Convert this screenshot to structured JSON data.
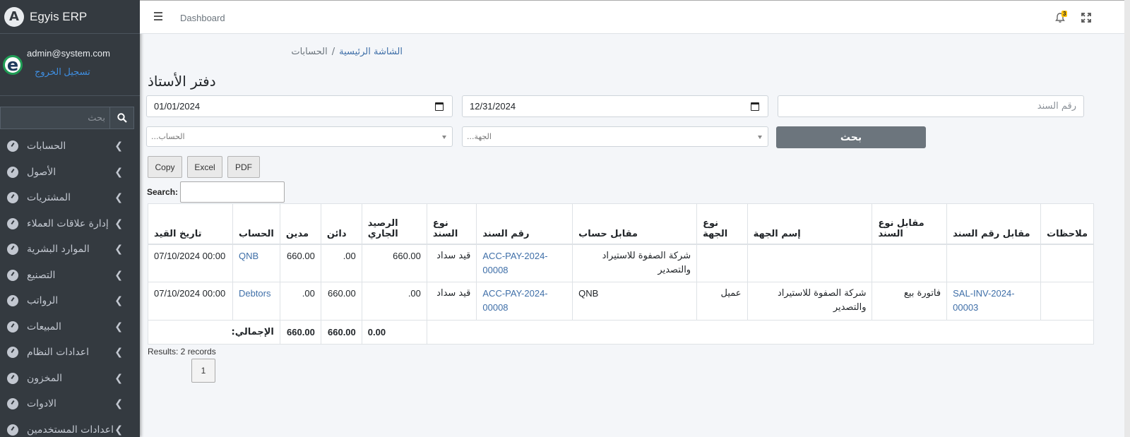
{
  "brand": {
    "logo_letter": "A",
    "name": "Egyis ERP"
  },
  "user": {
    "avatar_letter": "e",
    "email": "admin@system.com",
    "logout": "تسجيل الخروج"
  },
  "sidebar": {
    "search_placeholder": "بحث",
    "items": [
      {
        "label": "الحسابات"
      },
      {
        "label": "الأصول"
      },
      {
        "label": "المشتريات"
      },
      {
        "label": "إدارة علاقات العملاء"
      },
      {
        "label": "الموارد البشرية"
      },
      {
        "label": "التصنيع"
      },
      {
        "label": "الرواتب"
      },
      {
        "label": "المبيعات"
      },
      {
        "label": "اعدادات النظام"
      },
      {
        "label": "المخزون"
      },
      {
        "label": "الادوات"
      },
      {
        "label": "اعدادات المستخدمين"
      }
    ]
  },
  "topbar": {
    "link": "Dashboard",
    "notification_count": "3"
  },
  "breadcrumb": {
    "home": "الشاشة الرئيسية",
    "separator": "/",
    "current": "الحسابات"
  },
  "page_title": "دفتر الأستاذ",
  "filters": {
    "date_from": "01/01/2024",
    "date_to": "12/31/2024",
    "voucher_placeholder": "رقم السند",
    "account_placeholder": "الحساب...",
    "party_placeholder": "الجهة...",
    "search_button": "بحث"
  },
  "datatable": {
    "buttons": {
      "copy": "Copy",
      "excel": "Excel",
      "pdf": "PDF"
    },
    "search_label": "Search:",
    "results": "Results: 2 records",
    "page": "1"
  },
  "table": {
    "headers": {
      "date": "تاريخ القيد",
      "account": "الحساب",
      "debit": "مدين",
      "credit": "دائن",
      "balance": "الرصيد الجاري",
      "voucher_type": "نوع السند",
      "voucher_no": "رقم السند",
      "counter_account": "مقابل حساب",
      "party_type": "نوع الجهة",
      "party_name": "إسم الجهة",
      "counter_voucher_type": "مقابل نوع السند",
      "counter_voucher_no": "مقابل رقم السند",
      "notes": "ملاحظات"
    },
    "rows": [
      {
        "date": "07/10/2024 00:00",
        "account": "QNB",
        "debit": "660.00",
        "credit": ".00",
        "balance": "660.00",
        "voucher_type": "قيد سداد",
        "voucher_no": "ACC-PAY-2024-00008",
        "counter_account": "شركة الصفوة للاستيراد والتصدير",
        "party_type": "",
        "party_name": "",
        "counter_voucher_type": "",
        "counter_voucher_no": "",
        "notes": ""
      },
      {
        "date": "07/10/2024 00:00",
        "account": "Debtors",
        "debit": ".00",
        "credit": "660.00",
        "balance": ".00",
        "voucher_type": "قيد سداد",
        "voucher_no": "ACC-PAY-2024-00008",
        "counter_account": "QNB",
        "party_type": "عميل",
        "party_name": "شركة الصفوة للاستيراد والتصدير",
        "counter_voucher_type": "فاتورة بيع",
        "counter_voucher_no": "SAL-INV-2024-00003",
        "notes": ""
      }
    ],
    "totals": {
      "label": ":الإجمالي",
      "debit": "660.00",
      "credit": "660.00",
      "balance": "0.00"
    }
  }
}
